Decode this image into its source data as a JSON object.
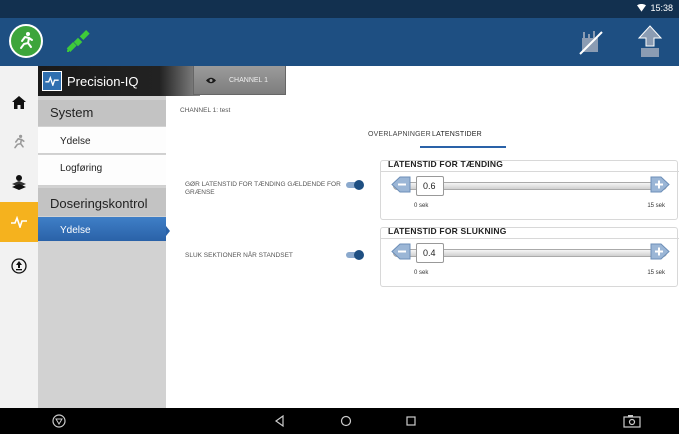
{
  "status_bar": {
    "time": "15:38"
  },
  "app_bar": {
    "logo_icon": "running-person-icon",
    "gps_icon": "satellite-icon",
    "right_icons": [
      "field-crossed-icon",
      "upload-field-icon"
    ]
  },
  "rail": {
    "items": [
      {
        "icon": "home-icon"
      },
      {
        "icon": "running-person-icon"
      },
      {
        "icon": "layers-icon"
      },
      {
        "icon": "pulse-icon",
        "active": true
      },
      {
        "icon": "upload-icon"
      }
    ]
  },
  "submenu": {
    "header": "Precision-IQ",
    "groups": [
      {
        "label": "System",
        "items": [
          "Ydelse",
          "Logføring"
        ]
      },
      {
        "label": "Doseringskontrol",
        "items": [
          "Ydelse"
        ]
      }
    ]
  },
  "channel_tab": {
    "label": "CHANNEL 1"
  },
  "channel_info": "CHANNEL 1: test",
  "tabs": {
    "overlap": "OVERLAPNINGER",
    "latency": "LATENSTIDER",
    "active": "LATENSTIDER"
  },
  "settings": {
    "turn_on_label": "GØR LATENSTID FOR TÆNDING GÆLDENDE FOR GRÆNSE",
    "turn_off_label": "SLUK SEKTIONER NÅR STANDSET"
  },
  "latency_on": {
    "title": "LATENSTID FOR TÆNDING",
    "value": "0.6",
    "min": "0 sek",
    "max": "15 sek"
  },
  "latency_off": {
    "title": "LATENSTID FOR SLUKNING",
    "value": "0.4",
    "min": "0 sek",
    "max": "15 sek"
  },
  "nav": {
    "left_icon": "trimble-icon",
    "back_icon": "back-icon",
    "home_icon": "home-circle-icon",
    "recent_icon": "recent-apps-icon",
    "camera_icon": "screenshot-icon"
  },
  "colors": {
    "app_bar": "#1e4f82",
    "accent": "#f5b21e",
    "green": "#3da53b",
    "selection": "#2a62a8"
  }
}
